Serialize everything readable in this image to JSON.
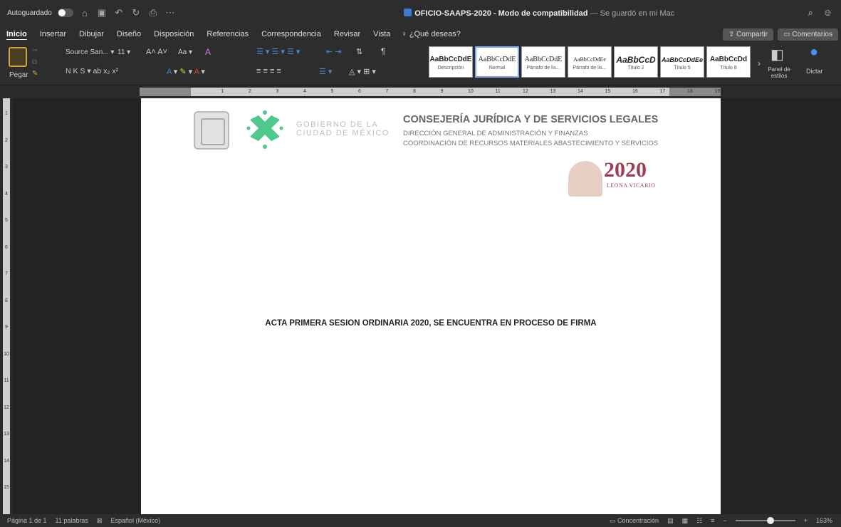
{
  "titlebar": {
    "autosave_label": "Autoguardado",
    "doc_title": "OFICIO-SAAPS-2020",
    "mode": "- Modo de compatibilidad",
    "saved_status": "— Se guardó en mi Mac",
    "icons": [
      "home-icon",
      "save-icon",
      "undo-icon",
      "redo-icon",
      "print-icon",
      "more-icon",
      "search-icon",
      "smiley-icon"
    ]
  },
  "tabs": {
    "items": [
      "Inicio",
      "Insertar",
      "Dibujar",
      "Diseño",
      "Disposición",
      "Referencias",
      "Correspondencia",
      "Revisar",
      "Vista"
    ],
    "active": "Inicio",
    "tell_me": "¿Qué deseas?",
    "share_label": "Compartir",
    "comments_label": "Comentarios"
  },
  "ribbon": {
    "paste_label": "Pegar",
    "font_name": "Source San...",
    "font_size": "11",
    "format_row": "N  K  S ▾ ab  x₂  x²",
    "styles": [
      {
        "sample": "AaBbCcDdE",
        "label": "Descripción"
      },
      {
        "sample": "AaBbCcDdE",
        "label": "Normal"
      },
      {
        "sample": "AaBbCcDdE",
        "label": "Párrafo de lis..."
      },
      {
        "sample": "AaBbCcDdEe",
        "label": "Párrafo de lis..."
      },
      {
        "sample": "AaBbCcD",
        "label": "Título 2"
      },
      {
        "sample": "AaBbCcDdEe",
        "label": "Título 5"
      },
      {
        "sample": "AaBbCcDd",
        "label": "Título 8"
      }
    ],
    "selected_style": "Normal",
    "styles_pane_label": "Panel de estilos",
    "dictate_label": "Dictar"
  },
  "ruler": {
    "numbers": [
      "1",
      "2",
      "3",
      "4",
      "5",
      "6",
      "7",
      "8",
      "9",
      "10",
      "11",
      "12",
      "13",
      "14",
      "15",
      "16",
      "17",
      "18",
      "19"
    ],
    "vertical_numbers": [
      "1",
      "2",
      "3",
      "4",
      "5",
      "6",
      "7",
      "8",
      "9",
      "10",
      "11",
      "12",
      "13",
      "14",
      "15"
    ]
  },
  "document": {
    "gob_line1": "GOBIERNO DE LA",
    "gob_line2": "CIUDAD DE MÉXICO",
    "consejeria": "CONSEJERÍA JURÍDICA Y DE SERVICIOS LEGALES",
    "direccion": "DIRECCIÓN GENERAL DE ADMINISTRACIÓN Y FINANZAS",
    "coordinacion": "COORDINACIÓN DE RECURSOS MATERIALES ABASTECIMIENTO Y SERVICIOS",
    "logo_year": "2020",
    "logo_name": "LEONA VICARIO",
    "body": "ACTA  PRIMERA SESION ORDINARIA 2020, SE ENCUENTRA EN PROCESO DE FIRMA"
  },
  "statusbar": {
    "page": "Página 1 de 1",
    "words": "11 palabras",
    "language": "Español (México)",
    "focus": "Concentración",
    "zoom": "163%",
    "zoom_fraction": 0.6
  },
  "colors": {
    "cdmx_green": "#4ec88b",
    "leona_maroon": "#9e3e55",
    "accent_blue": "#3b7bd4"
  }
}
